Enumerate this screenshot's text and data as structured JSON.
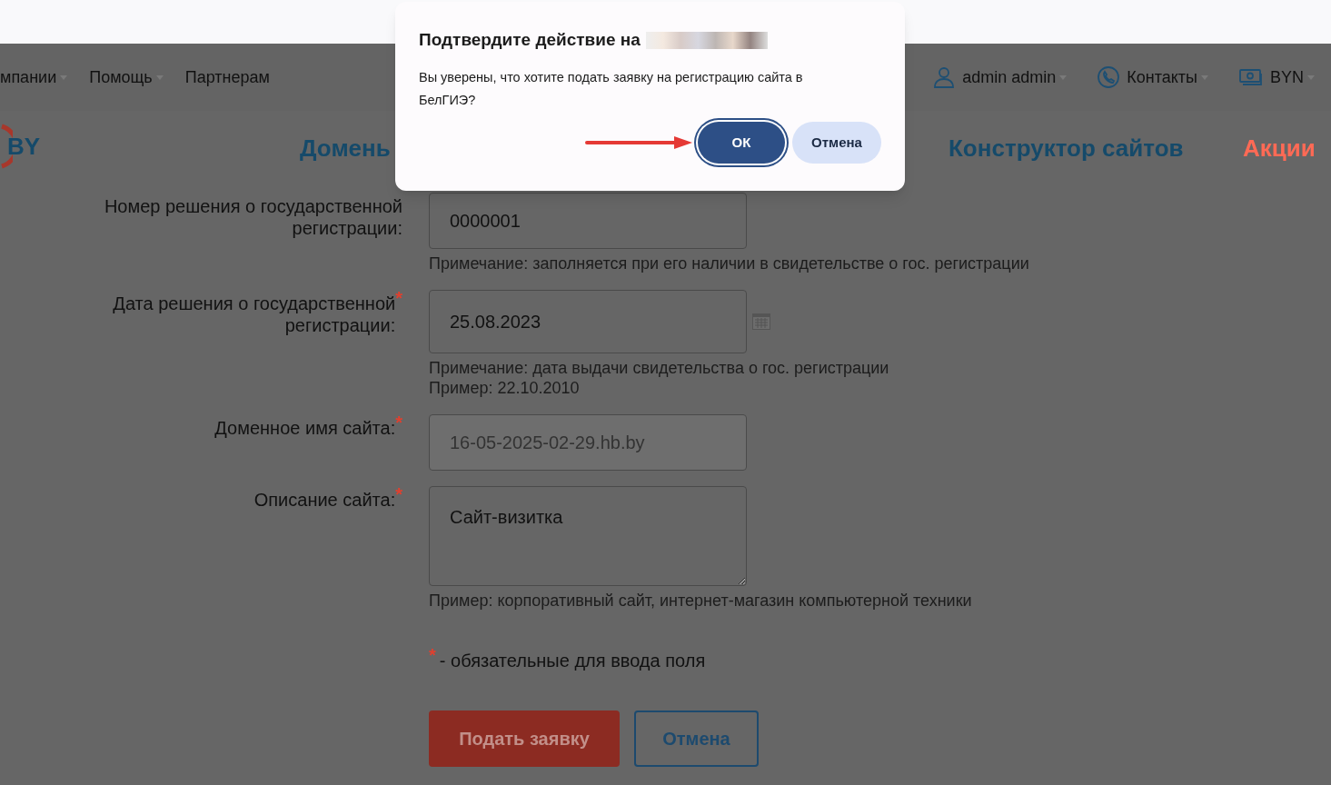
{
  "top_nav": {
    "left": [
      {
        "label": "мпании",
        "dropdown": true
      },
      {
        "label": "Помощь",
        "dropdown": true
      },
      {
        "label": "Партнерам",
        "dropdown": false
      }
    ],
    "right": [
      {
        "label": "admin admin",
        "kind": "user",
        "dropdown": true
      },
      {
        "label": "Контакты",
        "kind": "phone",
        "dropdown": true
      },
      {
        "label": "BYN",
        "kind": "money",
        "dropdown": true
      }
    ]
  },
  "header": {
    "logo": "BY",
    "menu": [
      {
        "label": "Домень",
        "kind": "regular"
      },
      {
        "label": "Конструктор сайтов",
        "kind": "regular"
      },
      {
        "label": "Акции",
        "kind": "promo"
      }
    ]
  },
  "form": {
    "fields": [
      {
        "label": "Номер решения о государственной регистрации:",
        "required": false,
        "kind": "input",
        "value": "0000001",
        "notes": [
          "Примечание: заполняется при его наличии в свидетельстве о гос. регистрации"
        ]
      },
      {
        "label": "Дата решения о государственной регистрации:",
        "required": true,
        "kind": "date",
        "value": "25.08.2023",
        "notes": [
          "Примечание: дата выдачи свидетельства о гос. регистрации",
          "Пример: 22.10.2010"
        ]
      },
      {
        "label": "Доменное имя сайта:",
        "required": true,
        "kind": "input",
        "value": "16-05-2025-02-29.hb.by",
        "disabled": true
      },
      {
        "label": "Описание сайта:",
        "required": true,
        "kind": "textarea",
        "value": "Сайт-визитка",
        "notes": [
          "Пример: корпоративный сайт, интернет-магазин компьютерной техники"
        ]
      }
    ],
    "required_mark": "*",
    "required_note": "- обязательные для ввода поля",
    "buttons": [
      {
        "label": "Подать заявку",
        "kind": "primary"
      },
      {
        "label": "Отмена",
        "kind": "secondary"
      }
    ]
  },
  "dialog": {
    "title": "Подтвердите действие на",
    "message": "Вы уверены, что хотите подать заявку на регистрацию сайта в БелГИЭ?",
    "buttons": [
      {
        "label": "ОК",
        "kind": "primary",
        "focused": true
      },
      {
        "label": "Отмена",
        "kind": "secondary",
        "focused": false
      }
    ]
  }
}
